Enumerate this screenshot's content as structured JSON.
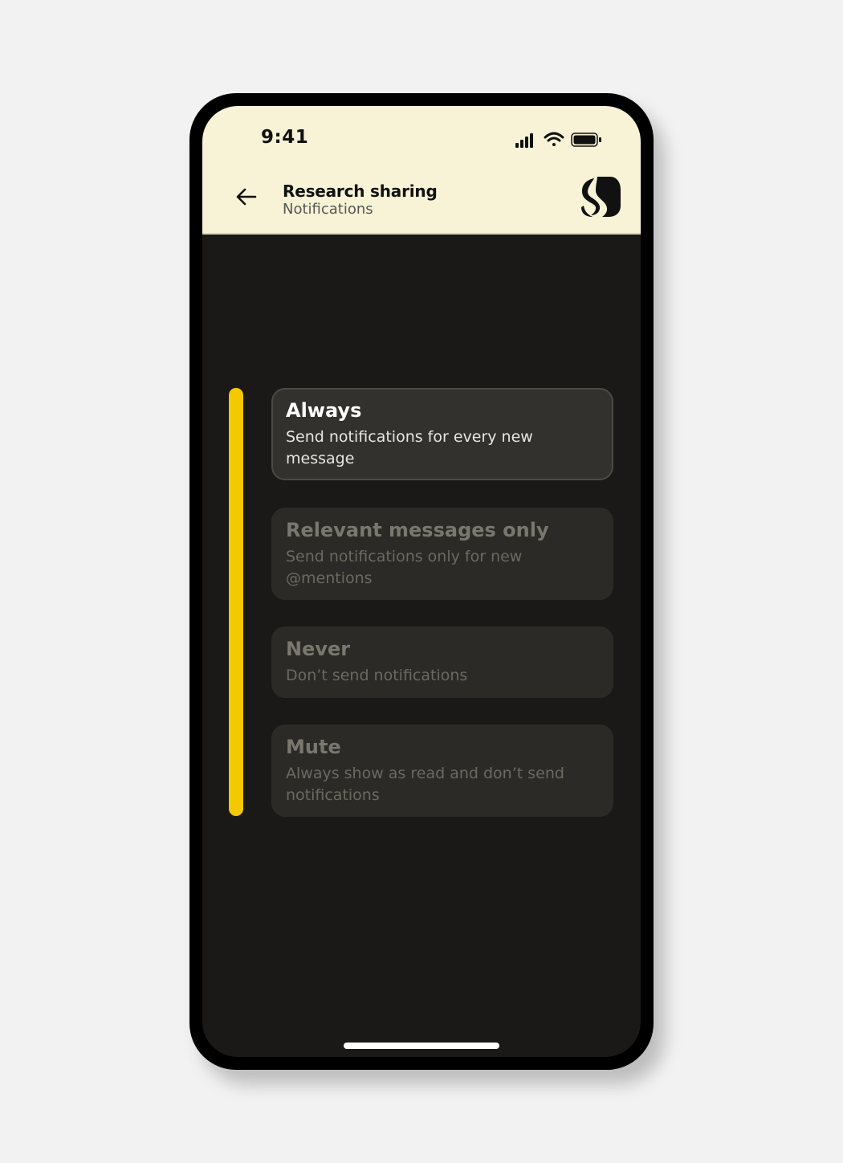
{
  "status_bar": {
    "time": "9:41",
    "icons": [
      "cellular-signal-icon",
      "wifi-icon",
      "battery-icon"
    ]
  },
  "header": {
    "title": "Research sharing",
    "subtitle": "Notifications",
    "back_icon": "arrow-left-icon",
    "logo_icon": "s-logo-icon"
  },
  "options": [
    {
      "title": "Always",
      "description": "Send notifications for every new message",
      "selected": true
    },
    {
      "title": "Relevant messages only",
      "description": "Send notifications only for new @mentions",
      "selected": false
    },
    {
      "title": "Never",
      "description": "Don’t send notifications",
      "selected": false
    },
    {
      "title": "Mute",
      "description": "Always show as read and don’t send notifications",
      "selected": false
    }
  ],
  "colors": {
    "accent": "#f4c900",
    "header_background": "#f8f3d6",
    "screen_background": "#1a1917"
  }
}
